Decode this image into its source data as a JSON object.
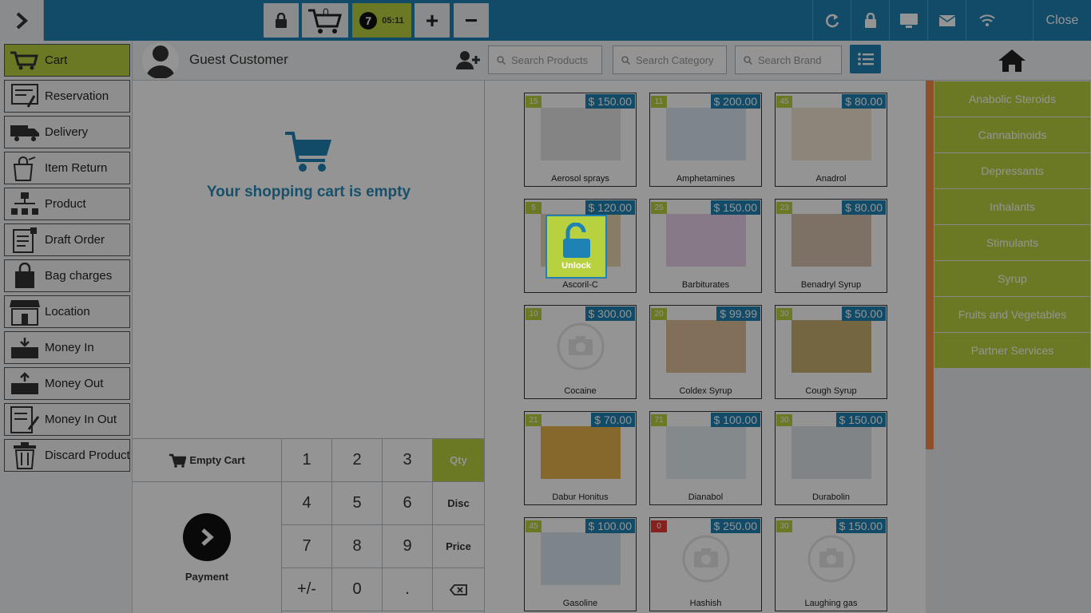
{
  "topbar": {
    "cart_count": "0",
    "timer_badge": "7",
    "timer": "05:11",
    "plus": "+",
    "minus": "−",
    "close": "Close"
  },
  "sidebar": {
    "items": [
      {
        "label": "Cart",
        "icon": "cart-icon",
        "active": true
      },
      {
        "label": "Reservation",
        "icon": "reservation-icon"
      },
      {
        "label": "Delivery",
        "icon": "delivery-truck-icon"
      },
      {
        "label": "Item Return",
        "icon": "item-return-icon"
      },
      {
        "label": "Product",
        "icon": "product-hierarchy-icon"
      },
      {
        "label": "Draft Order",
        "icon": "draft-order-icon"
      },
      {
        "label": "Bag charges",
        "icon": "bag-icon"
      },
      {
        "label": "Location",
        "icon": "store-location-icon"
      },
      {
        "label": "Money In",
        "icon": "money-in-icon"
      },
      {
        "label": "Money Out",
        "icon": "money-out-icon"
      },
      {
        "label": "Money In Out",
        "icon": "money-in-out-icon"
      },
      {
        "label": "Discard Product",
        "icon": "trash-icon"
      }
    ]
  },
  "customer": {
    "name": "Guest Customer"
  },
  "cart": {
    "empty_message": "Your shopping cart is empty"
  },
  "keypad": {
    "empty_cart": "Empty Cart",
    "payment": "Payment",
    "keys": [
      "1",
      "2",
      "3",
      "Qty",
      "4",
      "5",
      "6",
      "Disc",
      "7",
      "8",
      "9",
      "Price",
      "+/-",
      "0",
      ".",
      "⌫"
    ]
  },
  "search": {
    "products_placeholder": "Search Products",
    "category_placeholder": "Search Category",
    "brand_placeholder": "Search Brand"
  },
  "unlock": {
    "label": "Unlock"
  },
  "products": [
    {
      "name": "Aerosol sprays",
      "price": "$ 150.00",
      "stock": "15"
    },
    {
      "name": "Amphetamines",
      "price": "$ 200.00",
      "stock": "11"
    },
    {
      "name": "Anadrol",
      "price": "$ 80.00",
      "stock": "45"
    },
    {
      "name": "Ascoril-C",
      "price": "$ 120.00",
      "stock": "5"
    },
    {
      "name": "Barbiturates",
      "price": "$ 150.00",
      "stock": "25"
    },
    {
      "name": "Benadryl Syrup",
      "price": "$ 80.00",
      "stock": "23"
    },
    {
      "name": "Cocaine",
      "price": "$ 300.00",
      "stock": "10"
    },
    {
      "name": "Coldex Syrup",
      "price": "$ 99.99",
      "stock": "20"
    },
    {
      "name": "Cough Syrup",
      "price": "$ 50.00",
      "stock": "30"
    },
    {
      "name": "Dabur Honitus",
      "price": "$ 70.00",
      "stock": "21"
    },
    {
      "name": "Dianabol",
      "price": "$ 100.00",
      "stock": "71"
    },
    {
      "name": "Durabolin",
      "price": "$ 150.00",
      "stock": "30"
    },
    {
      "name": "Gasoline",
      "price": "$ 100.00",
      "stock": "45"
    },
    {
      "name": "Hashish",
      "price": "$ 250.00",
      "stock": "0"
    },
    {
      "name": "Laughing gas",
      "price": "$ 150.00",
      "stock": "30"
    }
  ],
  "categories": [
    "Anabolic Steroids",
    "Cannabinoids",
    "Depressants",
    "Inhalants",
    "Stimulants",
    "Syrup",
    "Fruits and Vegetables",
    "Partner Services"
  ],
  "colors": {
    "primary_blue": "#1e82b4",
    "accent_green": "#b8d13e",
    "stock_zero_red": "#e53935",
    "scroll_orange": "#f58a4b"
  }
}
